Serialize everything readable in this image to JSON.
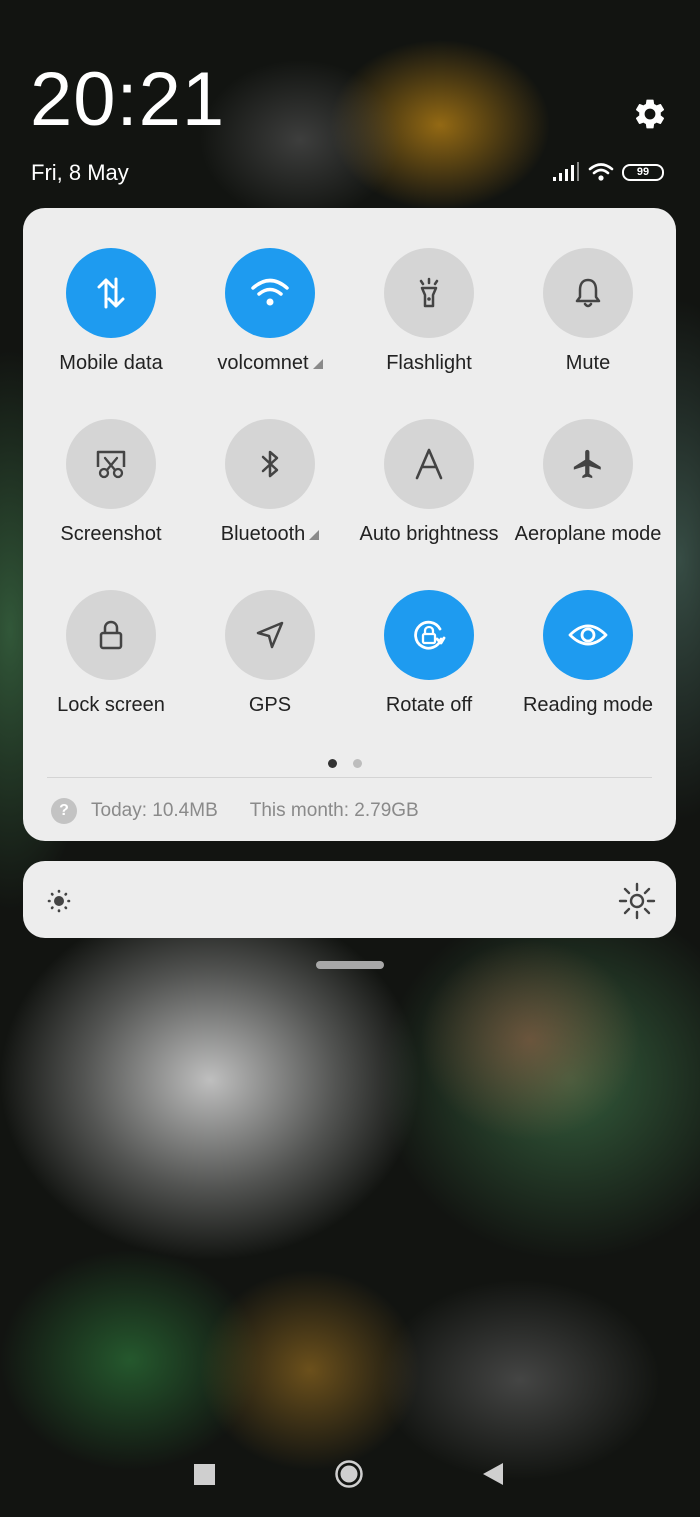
{
  "status_bar": {
    "time": "20:21",
    "date": "Fri, 8 May",
    "battery_level": "99"
  },
  "tiles": [
    {
      "label": "Mobile data",
      "icon": "mobile-data-icon",
      "active": true
    },
    {
      "label": "volcomnet",
      "icon": "wifi-icon",
      "active": true
    },
    {
      "label": "Flashlight",
      "icon": "flashlight-icon",
      "active": false
    },
    {
      "label": "Mute",
      "icon": "bell-icon",
      "active": false
    },
    {
      "label": "Screenshot",
      "icon": "screenshot-icon",
      "active": false
    },
    {
      "label": "Bluetooth",
      "icon": "bluetooth-icon",
      "active": false
    },
    {
      "label": "Auto brightness",
      "icon": "auto-brightness-icon",
      "active": false
    },
    {
      "label": "Aeroplane mode",
      "icon": "airplane-icon",
      "active": false
    },
    {
      "label": "Lock screen",
      "icon": "lock-icon",
      "active": false
    },
    {
      "label": "GPS",
      "icon": "location-arrow-icon",
      "active": false
    },
    {
      "label": "Rotate off",
      "icon": "rotation-lock-icon",
      "active": true
    },
    {
      "label": "Reading mode",
      "icon": "eye-icon",
      "active": true
    }
  ],
  "pagination": {
    "current": 1,
    "total": 2
  },
  "data_usage": {
    "icon_text": "?",
    "today": "Today: 10.4MB",
    "month": "This month: 2.79GB"
  },
  "colors": {
    "active_tile": "#1e9bf0",
    "inactive_tile": "#d5d5d5",
    "panel_background": "#ededed"
  }
}
